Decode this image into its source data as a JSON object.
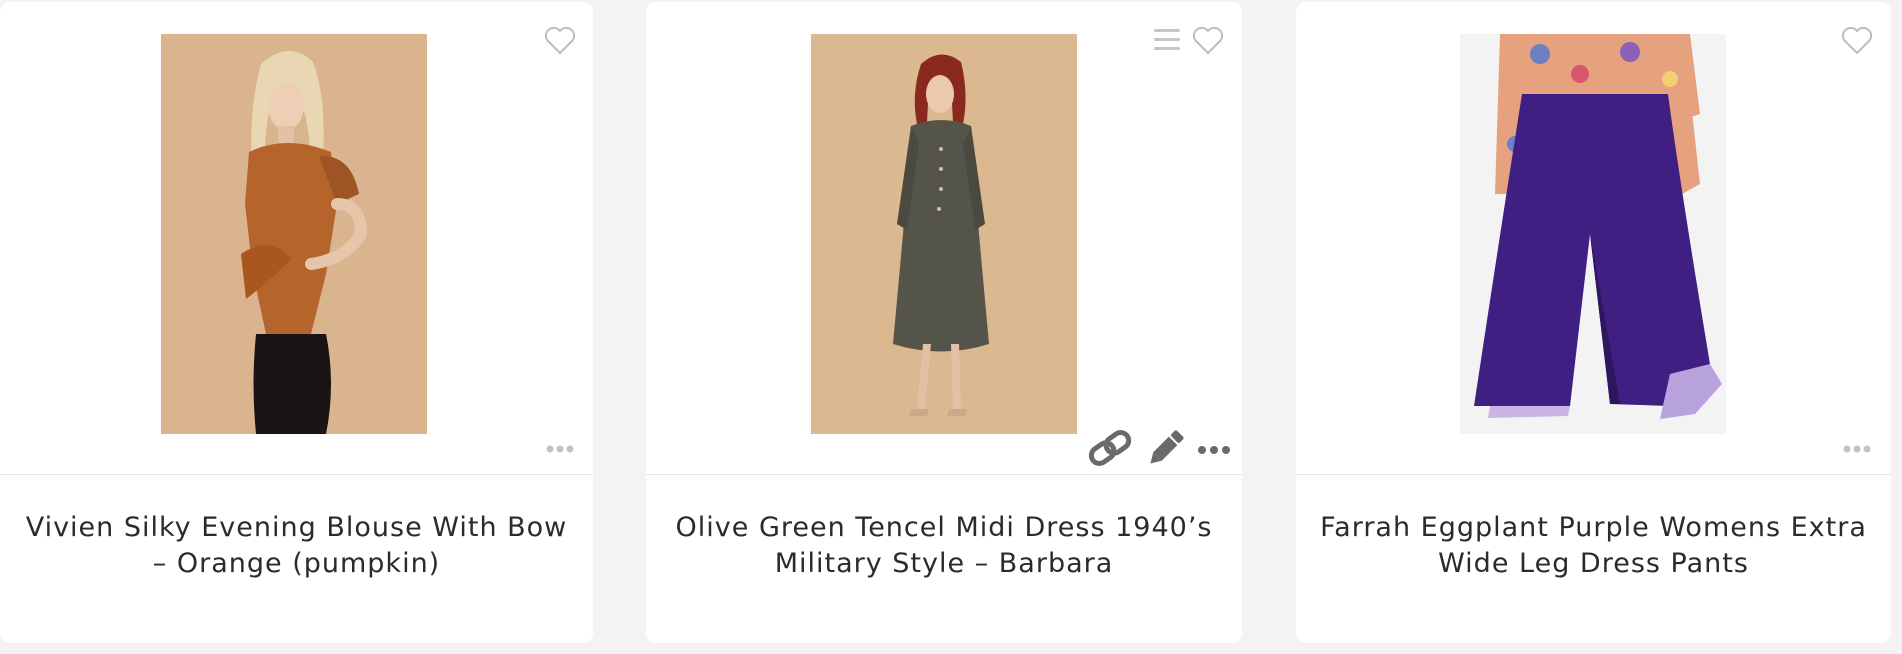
{
  "products": [
    {
      "title": "Vivien Silky Evening Blouse With Bow – Orange (pumpkin)",
      "image_background": "#d9b48f",
      "garment_color": "#b5642c"
    },
    {
      "title": "Olive Green Tencel Midi Dress 1940’s Military Style – Barbara",
      "image_background": "#dcb890",
      "garment_color": "#55544a"
    },
    {
      "title": "Farrah Eggplant Purple Womens Extra Wide Leg Dress Pants",
      "image_background": "#f3f3f3",
      "garment_color": "#3f1f82"
    }
  ],
  "icons": {
    "wishlist": "heart-outline-icon",
    "list": "list-icon",
    "more": "more-dots-icon",
    "link": "link-icon",
    "edit": "pencil-icon"
  },
  "colors": {
    "page_background": "#f3f3f3",
    "card_background": "#ffffff",
    "icon_light": "#bdbdbd",
    "icon_dark": "#6a6a6a",
    "title_text": "#2b2b2b"
  }
}
